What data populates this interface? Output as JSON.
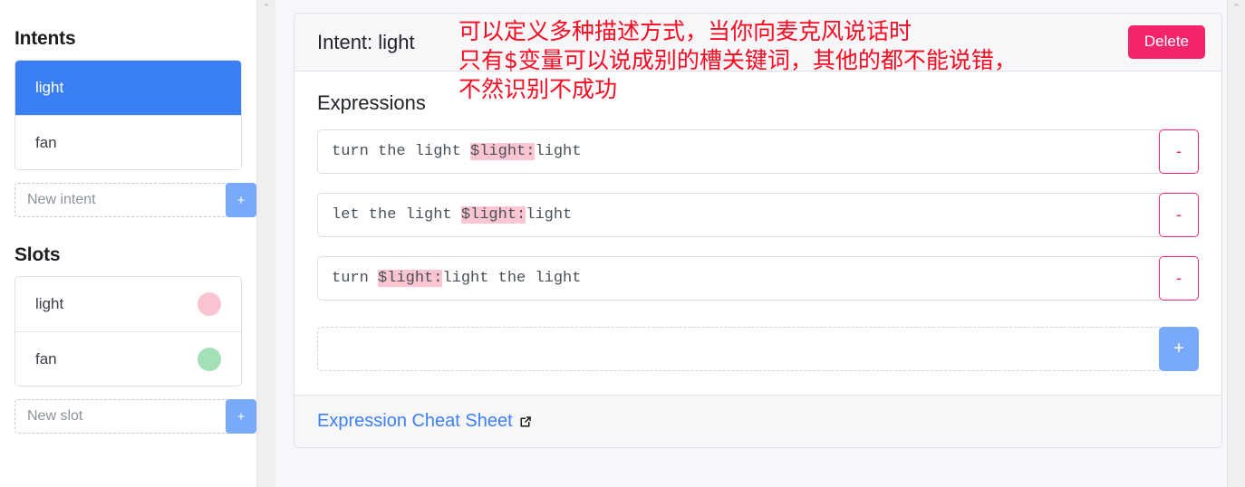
{
  "sidebar": {
    "intents_title": "Intents",
    "intents": [
      {
        "label": "light",
        "active": true
      },
      {
        "label": "fan",
        "active": false
      }
    ],
    "new_intent_placeholder": "New intent",
    "new_intent_value": "",
    "add_intent_label": "+",
    "slots_title": "Slots",
    "slots": [
      {
        "label": "light",
        "color": "#fbc4d2"
      },
      {
        "label": "fan",
        "color": "#a3e0b8"
      }
    ],
    "new_slot_placeholder": "New slot",
    "new_slot_value": "",
    "add_slot_label": "+"
  },
  "card": {
    "header_title": "Intent: light",
    "delete_label": "Delete",
    "body_title": "Expressions",
    "expressions": [
      {
        "prefix": "turn the light ",
        "token": "$light:",
        "suffix": "light",
        "remove_label": "-"
      },
      {
        "prefix": "let the light ",
        "token": "$light:",
        "suffix": "light",
        "remove_label": "-"
      },
      {
        "prefix": "turn ",
        "token": "$light:",
        "suffix": "light the light",
        "remove_label": "-"
      }
    ],
    "new_expression_placeholder": "",
    "new_expression_value": "",
    "add_expression_label": "+",
    "footer_link_label": "Expression Cheat Sheet"
  },
  "annotation": {
    "line1": "可以定义多种描述方式，当你向麦克风说话时",
    "line2": "只有$变量可以说成别的槽关键词，其他的都不能说错，",
    "line3": "不然识别不成功",
    "color": "#fc0a21"
  },
  "scrollbars": {
    "up_arrow": "⌃"
  },
  "colors": {
    "accent_blue": "#3b7ff5",
    "light_blue": "#79a9fb",
    "danger": "#f4246a",
    "highlight": "#fbc6d2"
  }
}
